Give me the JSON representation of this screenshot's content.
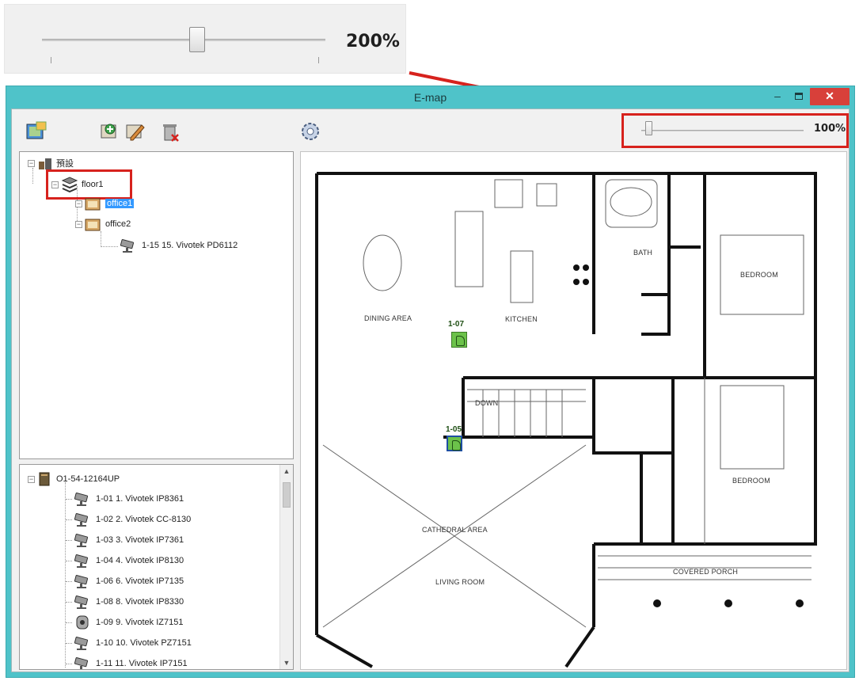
{
  "callout": {
    "zoom_value": "200%",
    "slider_level_percent": 200
  },
  "window": {
    "title": "E-map",
    "minimize_label": "–",
    "close_label": "✕"
  },
  "toolbar": {
    "icons": [
      "map-add-icon",
      "add-icon",
      "edit-icon",
      "delete-icon",
      "settings-icon"
    ],
    "zoom_value": "100%",
    "slider_level_percent": 100
  },
  "map_tree": {
    "root_label": "預設",
    "floor_label": "floor1",
    "office1_label": "office1",
    "office2_label": "office2",
    "camera_label": "1-15 15. Vivotek PD6112"
  },
  "device_tree": {
    "nvr_label": "O1-54-12164UP",
    "cameras": [
      "1-01 1. Vivotek IP8361",
      "1-02 2. Vivotek CC-8130",
      "1-03 3. Vivotek IP7361",
      "1-04 4. Vivotek IP8130",
      "1-06 6. Vivotek IP7135",
      "1-08 8. Vivotek IP8330",
      "1-09 9. Vivotek IZ7151",
      "1-10 10. Vivotek PZ7151",
      "1-11 11. Vivotek IP7151"
    ],
    "scroll_up": "▲",
    "scroll_down": "▼"
  },
  "floorplan": {
    "rooms": {
      "dining": "DINING AREA",
      "kitchen": "KITCHEN",
      "bath": "BATH",
      "bedroom_top": "BEDROOM",
      "bedroom_mid": "BEDROOM",
      "down": "DOWN",
      "cathedral": "CATHEDRAL AREA",
      "living": "LIVING ROOM",
      "porch": "COVERED PORCH"
    },
    "camera_markers": [
      {
        "label": "1-07",
        "active": false
      },
      {
        "label": "1-05",
        "active": true
      }
    ]
  },
  "colors": {
    "window_frame": "#4fc3c9",
    "highlight_red": "#d7221d",
    "selection_blue": "#3399ff",
    "camera_green": "#6cc24a"
  }
}
